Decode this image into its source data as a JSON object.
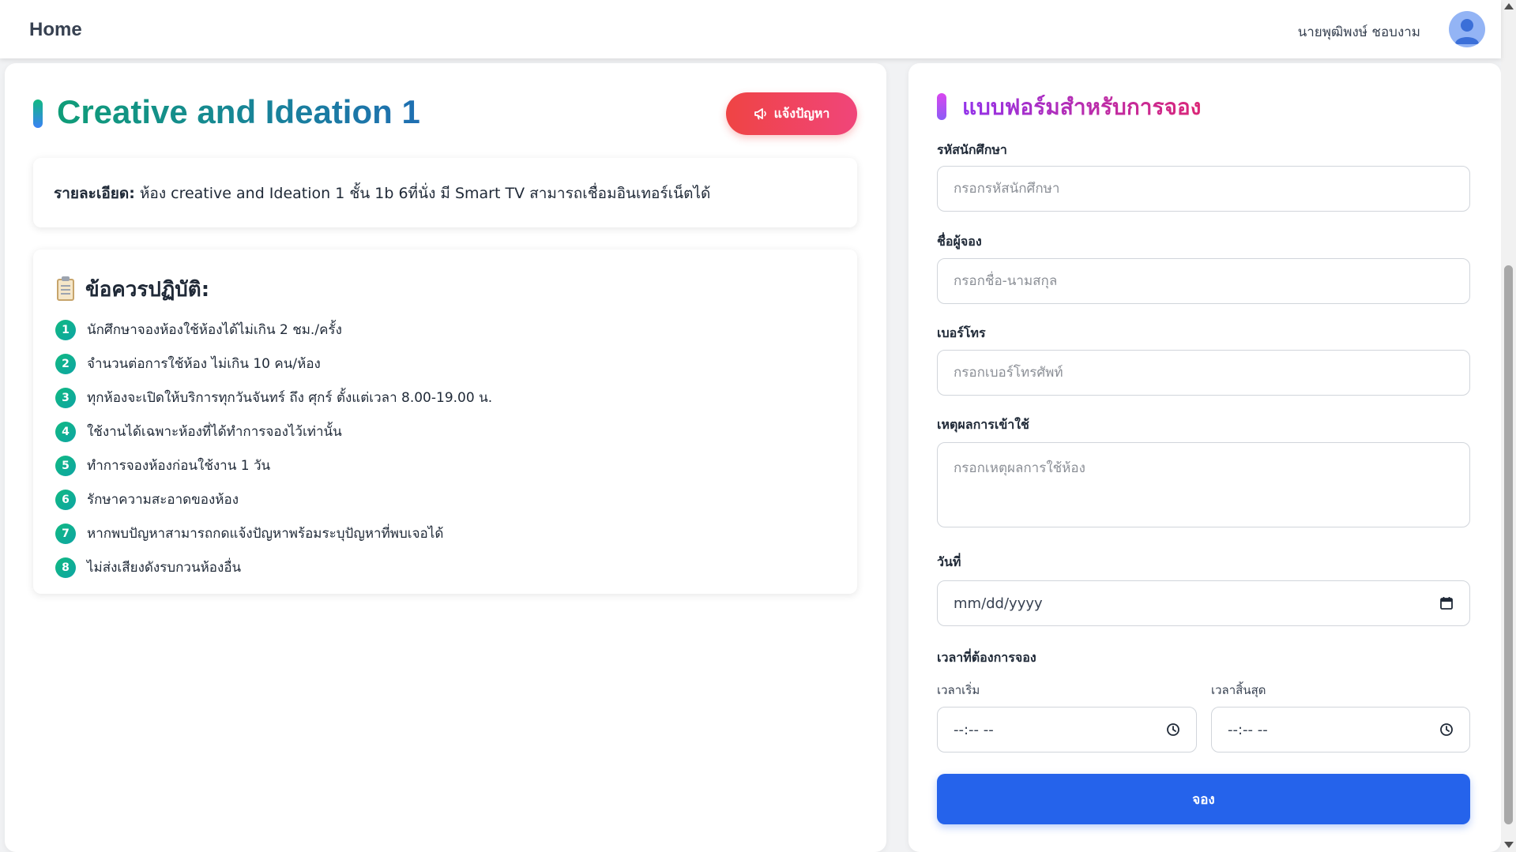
{
  "nav": {
    "home_label": "Home",
    "user_name": "นายพุฒิพงษ์ ชอบงาม"
  },
  "room": {
    "title": "Creative and Ideation 1",
    "report_button_label": "แจ้งปัญหา",
    "detail_label": "รายละเอียด:",
    "detail_text": " ห้อง creative and Ideation 1 ชั้น 1b 6ที่นั่ง มี Smart TV สามารถเชื่อมอินเทอร์เน็ตได้"
  },
  "rules": {
    "heading": "ข้อควรปฏิบัติ:",
    "items": [
      {
        "num": "1",
        "text": "นักศึกษาจองห้องใช้ห้องได้ไม่เกิน 2 ชม./ครั้ง"
      },
      {
        "num": "2",
        "text": "จำนวนต่อการใช้ห้อง ไม่เกิน 10 คน/ห้อง"
      },
      {
        "num": "3",
        "text": "ทุกห้องจะเปิดให้บริการทุกวันจันทร์ ถึง ศุกร์ ตั้งแต่เวลา 8.00-19.00 น."
      },
      {
        "num": "4",
        "text": "ใช้งานได้เฉพาะห้องที่ได้ทำการจองไว้เท่านั้น"
      },
      {
        "num": "5",
        "text": "ทำการจองห้องก่อนใช้งาน 1 วัน"
      },
      {
        "num": "6",
        "text": "รักษาความสะอาดของห้อง"
      },
      {
        "num": "7",
        "text": "หากพบปัญหาสามารถกดแจ้งปัญหาพร้อมระบุปัญหาที่พบเจอได้"
      },
      {
        "num": "8",
        "text": "ไม่ส่งเสียงดังรบกวนห้องอื่น"
      }
    ]
  },
  "form": {
    "title": "แบบฟอร์มสำหรับการจอง",
    "student_id": {
      "label": "รหัสนักศึกษา",
      "placeholder": "กรอกรหัสนักศึกษา",
      "value": ""
    },
    "name": {
      "label": "ชื่อผู้จอง",
      "placeholder": "กรอกชื่อ-นามสกุล",
      "value": ""
    },
    "phone": {
      "label": "เบอร์โทร",
      "placeholder": "กรอกเบอร์โทรศัพท์",
      "value": ""
    },
    "reason": {
      "label": "เหตุผลการเข้าใช้",
      "placeholder": "กรอกเหตุผลการใช้ห้อง",
      "value": ""
    },
    "date": {
      "label": "วันที่",
      "display": "mm/dd/yyyy"
    },
    "time": {
      "label": "เวลาที่ต้องการจอง",
      "start_label": "เวลาเริ่ม",
      "start_display": "--:-- --",
      "end_label": "เวลาสิ้นสุด",
      "end_display": "--:-- --"
    },
    "submit_label": "จอง"
  },
  "colors": {
    "accent_blue": "#2563eb",
    "report_red": "#ef4444",
    "title_green": "#0f9d78",
    "form_purple": "#9333ea",
    "badge_green": "#10b981"
  }
}
